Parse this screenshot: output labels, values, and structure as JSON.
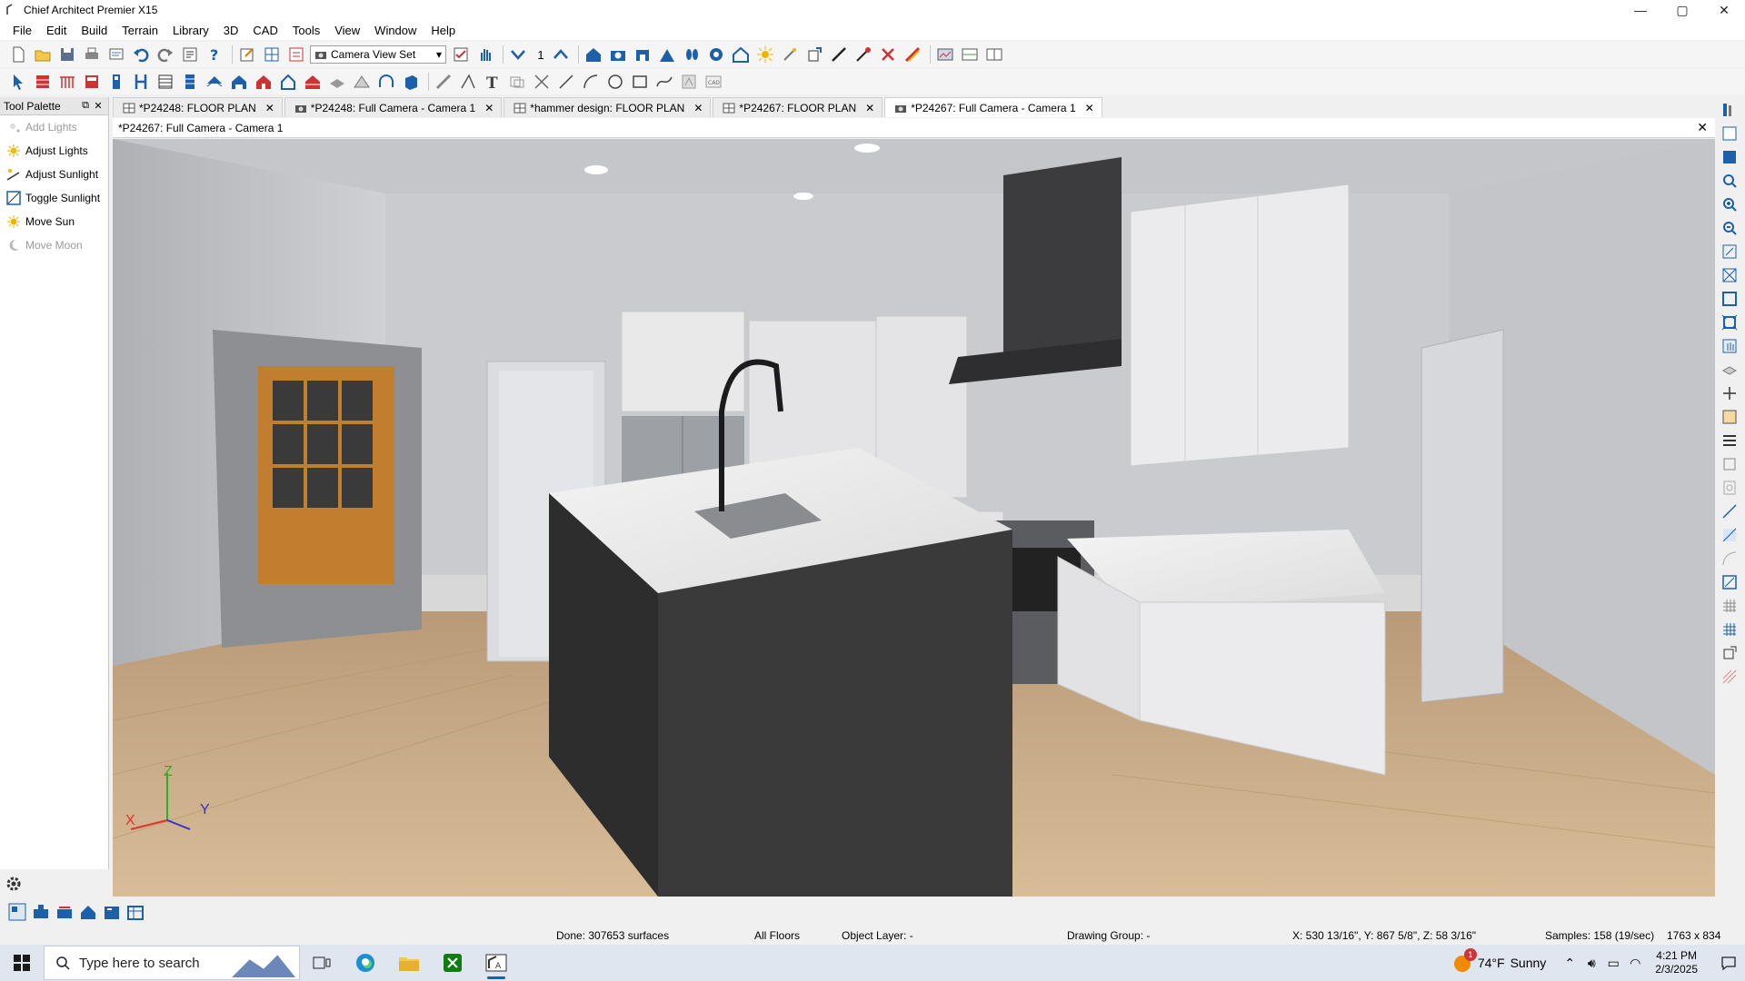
{
  "window": {
    "title": "Chief Architect Premier X15",
    "controls": [
      "—",
      "▢",
      "✕"
    ]
  },
  "menu": [
    "File",
    "Edit",
    "Build",
    "Terrain",
    "Library",
    "3D",
    "CAD",
    "Tools",
    "View",
    "Window",
    "Help"
  ],
  "toolbar": {
    "view_set_select": "Camera View Set",
    "floor_number": "1"
  },
  "palette": {
    "title": "Tool Palette",
    "items": [
      {
        "label": "Add Lights",
        "enabled": false
      },
      {
        "label": "Adjust Lights",
        "enabled": true
      },
      {
        "label": "Adjust Sunlight",
        "enabled": true
      },
      {
        "label": "Toggle Sunlight",
        "enabled": true
      },
      {
        "label": "Move Sun",
        "enabled": true
      },
      {
        "label": "Move Moon",
        "enabled": false
      }
    ]
  },
  "tabs": [
    {
      "label": "*P24248: FLOOR PLAN",
      "type": "plan",
      "active": false
    },
    {
      "label": "*P24248: Full Camera - Camera 1",
      "type": "camera",
      "active": false
    },
    {
      "label": "*hammer design: FLOOR PLAN",
      "type": "plan",
      "active": false
    },
    {
      "label": "*P24267: FLOOR PLAN",
      "type": "plan",
      "active": false
    },
    {
      "label": "*P24267: Full Camera - Camera 1",
      "type": "camera",
      "active": true
    }
  ],
  "view": {
    "title": "*P24267: Full Camera - Camera 1",
    "axes": {
      "x": "X",
      "y": "Y",
      "z": "Z"
    }
  },
  "status": {
    "done": "Done:  307653 surfaces",
    "floors": "All Floors",
    "layer": "Object Layer: -",
    "group": "Drawing Group: -",
    "coords": "X: 530 13/16\", Y: 867 5/8\", Z: 58 3/16\"",
    "samples": "Samples: 158 (19/sec)",
    "size": "1763 x 834"
  },
  "taskbar": {
    "search_placeholder": "Type here to search",
    "weather_temp": "74°F",
    "weather_cond": "Sunny",
    "weather_badge": "1",
    "time": "4:21 PM",
    "date": "2/3/2025"
  },
  "colors": {
    "accent": "#0067c0",
    "floor": "#c9ab88",
    "island_base": "#3b3a3a",
    "cabinet": "#e9e9ea",
    "wall": "#c9cbcf"
  }
}
